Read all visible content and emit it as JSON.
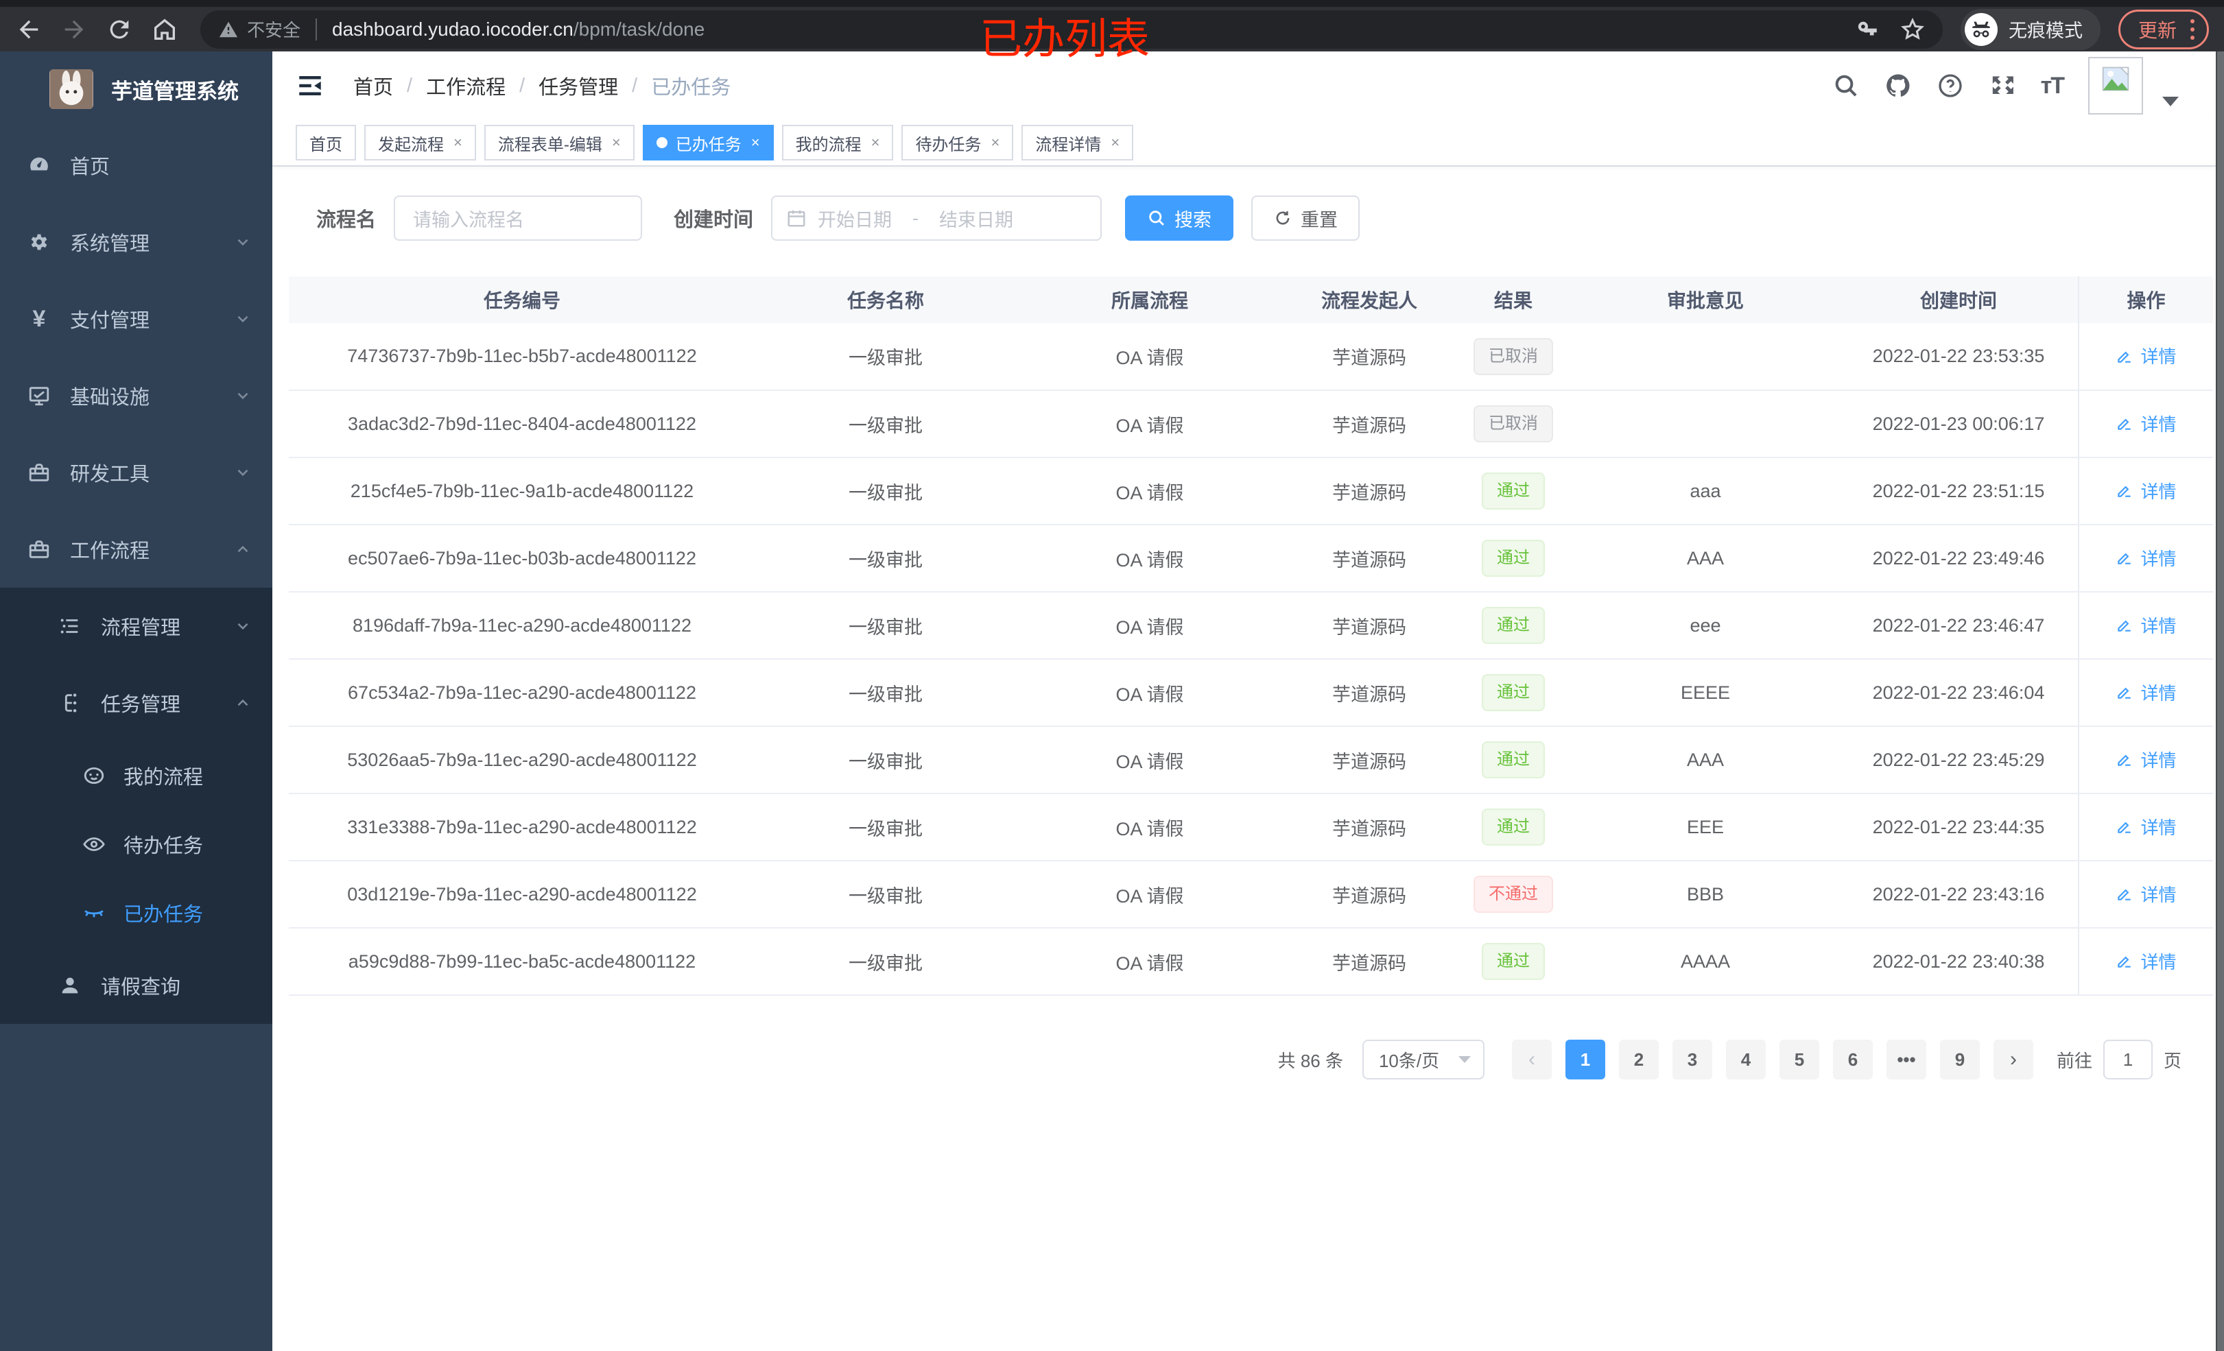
{
  "browser": {
    "security_label": "不安全",
    "url_host": "dashboard.yudao.iocoder.cn",
    "url_path": "/bpm/task/done",
    "incognito_label": "无痕模式",
    "update_label": "更新"
  },
  "annotation": {
    "text": "已办列表",
    "color": "#ff2600"
  },
  "sidebar": {
    "title": "芋道管理系统",
    "items": [
      {
        "label": "首页"
      },
      {
        "label": "系统管理"
      },
      {
        "label": "支付管理"
      },
      {
        "label": "基础设施"
      },
      {
        "label": "研发工具"
      },
      {
        "label": "工作流程"
      }
    ],
    "workflow_children": [
      {
        "label": "流程管理"
      },
      {
        "label": "任务管理"
      }
    ],
    "task_children": [
      {
        "label": "我的流程"
      },
      {
        "label": "待办任务"
      },
      {
        "label": "已办任务"
      }
    ],
    "leave_query": {
      "label": "请假查询"
    }
  },
  "header": {
    "breadcrumb": [
      "首页",
      "工作流程",
      "任务管理",
      "已办任务"
    ],
    "separator": "/"
  },
  "tabs": {
    "close_glyph": "×",
    "items": [
      {
        "label": "首页"
      },
      {
        "label": "发起流程"
      },
      {
        "label": "流程表单-编辑"
      },
      {
        "label": "已办任务"
      },
      {
        "label": "我的流程"
      },
      {
        "label": "待办任务"
      },
      {
        "label": "流程详情"
      }
    ]
  },
  "search": {
    "name_label": "流程名",
    "name_placeholder": "请输入流程名",
    "time_label": "创建时间",
    "start_placeholder": "开始日期",
    "range_separator": "-",
    "end_placeholder": "结束日期",
    "search_label": "搜索",
    "reset_label": "重置"
  },
  "table": {
    "headers": [
      "任务编号",
      "任务名称",
      "所属流程",
      "流程发起人",
      "结果",
      "审批意见",
      "创建时间",
      "操作"
    ],
    "action_label": "详情",
    "rows": [
      {
        "id": "74736737-7b9b-11ec-b5b7-acde48001122",
        "name": "一级审批",
        "process": "OA 请假",
        "initiator": "芋道源码",
        "result": "已取消",
        "result_type": "cancel",
        "comment": "",
        "time": "2022-01-22 23:53:35"
      },
      {
        "id": "3adac3d2-7b9d-11ec-8404-acde48001122",
        "name": "一级审批",
        "process": "OA 请假",
        "initiator": "芋道源码",
        "result": "已取消",
        "result_type": "cancel",
        "comment": "",
        "time": "2022-01-23 00:06:17"
      },
      {
        "id": "215cf4e5-7b9b-11ec-9a1b-acde48001122",
        "name": "一级审批",
        "process": "OA 请假",
        "initiator": "芋道源码",
        "result": "通过",
        "result_type": "pass",
        "comment": "aaa",
        "time": "2022-01-22 23:51:15"
      },
      {
        "id": "ec507ae6-7b9a-11ec-b03b-acde48001122",
        "name": "一级审批",
        "process": "OA 请假",
        "initiator": "芋道源码",
        "result": "通过",
        "result_type": "pass",
        "comment": "AAA",
        "time": "2022-01-22 23:49:46"
      },
      {
        "id": "8196daff-7b9a-11ec-a290-acde48001122",
        "name": "一级审批",
        "process": "OA 请假",
        "initiator": "芋道源码",
        "result": "通过",
        "result_type": "pass",
        "comment": "eee",
        "time": "2022-01-22 23:46:47"
      },
      {
        "id": "67c534a2-7b9a-11ec-a290-acde48001122",
        "name": "一级审批",
        "process": "OA 请假",
        "initiator": "芋道源码",
        "result": "通过",
        "result_type": "pass",
        "comment": "EEEE",
        "time": "2022-01-22 23:46:04"
      },
      {
        "id": "53026aa5-7b9a-11ec-a290-acde48001122",
        "name": "一级审批",
        "process": "OA 请假",
        "initiator": "芋道源码",
        "result": "通过",
        "result_type": "pass",
        "comment": "AAA",
        "time": "2022-01-22 23:45:29"
      },
      {
        "id": "331e3388-7b9a-11ec-a290-acde48001122",
        "name": "一级审批",
        "process": "OA 请假",
        "initiator": "芋道源码",
        "result": "通过",
        "result_type": "pass",
        "comment": "EEE",
        "time": "2022-01-22 23:44:35"
      },
      {
        "id": "03d1219e-7b9a-11ec-a290-acde48001122",
        "name": "一级审批",
        "process": "OA 请假",
        "initiator": "芋道源码",
        "result": "不通过",
        "result_type": "reject",
        "comment": "BBB",
        "time": "2022-01-22 23:43:16"
      },
      {
        "id": "a59c9d88-7b99-11ec-ba5c-acde48001122",
        "name": "一级审批",
        "process": "OA 请假",
        "initiator": "芋道源码",
        "result": "通过",
        "result_type": "pass",
        "comment": "AAAA",
        "time": "2022-01-22 23:40:38"
      }
    ]
  },
  "pagination": {
    "total": "共 86 条",
    "page_size": "10条/页",
    "prev_glyph": "‹",
    "next_glyph": "›",
    "pages": [
      "1",
      "2",
      "3",
      "4",
      "5",
      "6",
      "•••",
      "9"
    ],
    "active_page": "1",
    "goto_label": "前往",
    "goto_value": "1",
    "unit_label": "页"
  },
  "colors": {
    "accent": "#409eff",
    "pass": "#67c23a",
    "reject": "#f56c6c",
    "cancel": "#909399",
    "annotation": "#ff2600",
    "update": "#ee8277"
  }
}
